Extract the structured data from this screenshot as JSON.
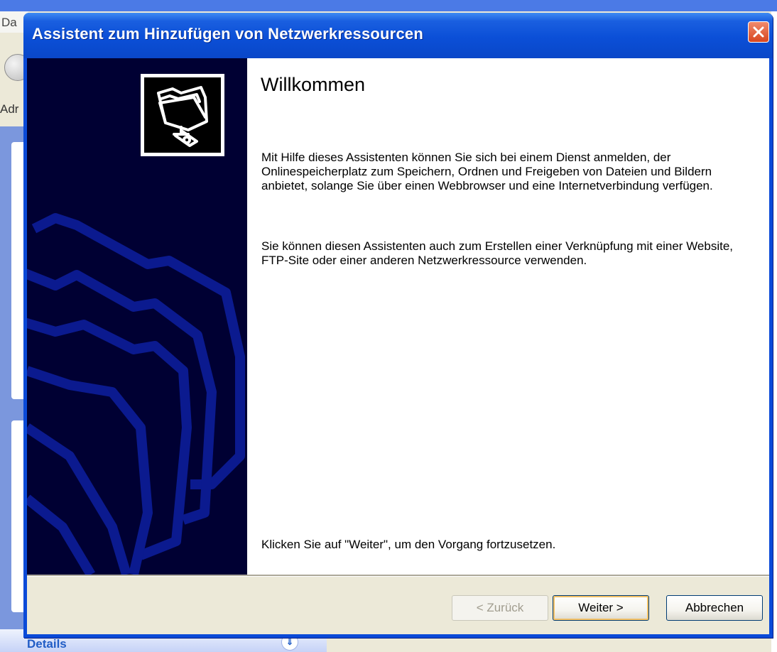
{
  "background_window": {
    "title_fragment": "Da",
    "address_fragment": "Adr",
    "details_label": "Details"
  },
  "dialog": {
    "title": "Assistent zum Hinzufügen von Netzwerkressourcen",
    "heading": "Willkommen",
    "paragraph1": "Mit Hilfe dieses Assistenten können Sie sich bei einem Dienst anmelden, der Onlinespeicherplatz zum Speichern, Ordnen und Freigeben von Dateien und Bildern anbietet, solange Sie über einen Webbrowser und eine Internetverbindung verfügen.",
    "paragraph2": "Sie können diesen Assistenten auch zum Erstellen einer Verknüpfung mit einer Website, FTP-Site oder einer anderen Netzwerkressource verwenden.",
    "continue_hint": "Klicken Sie auf \"Weiter\", um den Vorgang fortzusetzen.",
    "buttons": {
      "back": "< Zurück",
      "next": "Weiter >",
      "cancel": "Abbrechen"
    }
  },
  "icons": {
    "close": "close-icon",
    "wizard": "network-folder-icon",
    "watermark": "folders-watermark"
  },
  "colors": {
    "titlebar": "#0a4ad8",
    "banner": "#000033",
    "close_button": "#d8461f",
    "default_button_focus": "#f5c266"
  }
}
